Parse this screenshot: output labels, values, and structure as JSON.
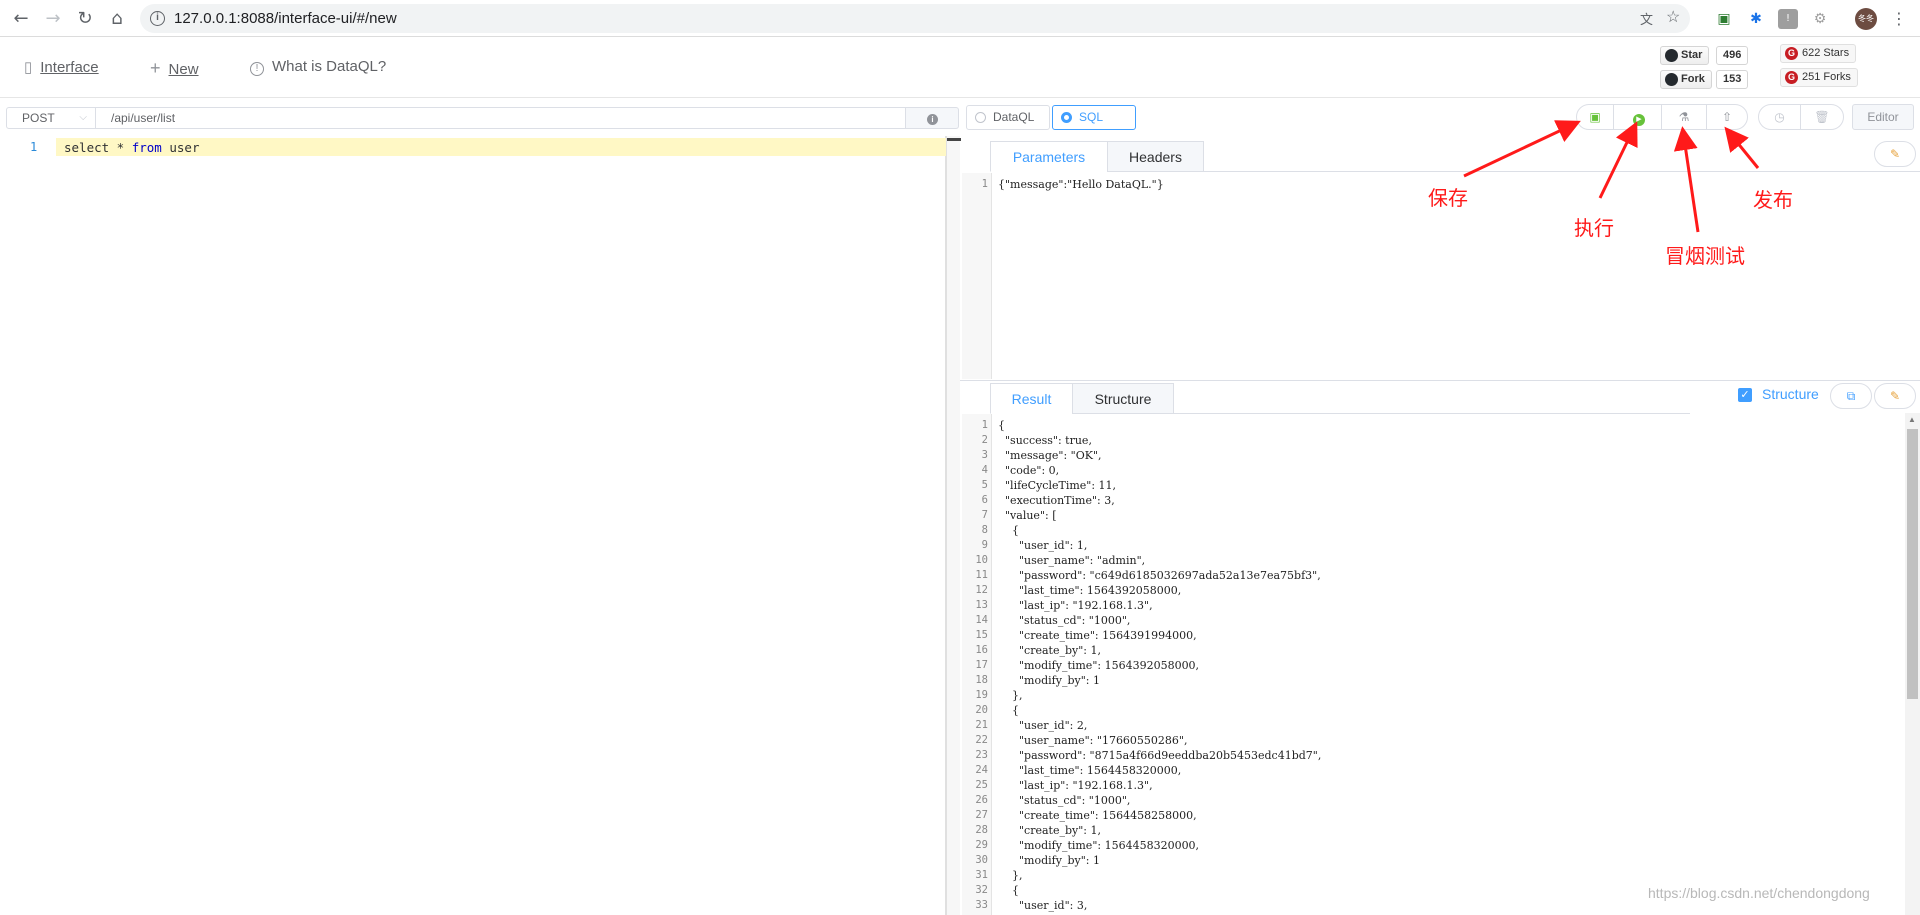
{
  "browser": {
    "url": "127.0.0.1:8088/interface-ui/#/new",
    "avatar_text": "冬冬"
  },
  "header": {
    "menu": [
      {
        "label": "Interface",
        "icon": "document-icon"
      },
      {
        "label": "New",
        "icon": "plus-icon"
      },
      {
        "label": "What is DataQL?",
        "icon": "info-circle-icon"
      }
    ],
    "github": {
      "star_label": "Star",
      "star_count": "496",
      "fork_label": "Fork",
      "fork_count": "153"
    },
    "gitee": {
      "stars": "622 Stars",
      "forks": "251 Forks"
    }
  },
  "request": {
    "method": "POST",
    "path": "/api/user/list"
  },
  "mode": {
    "options": [
      "DataQL",
      "SQL"
    ],
    "selected": "SQL"
  },
  "toolbar": {
    "editor_label": "Editor"
  },
  "editor": {
    "line_number": "1",
    "code_parts": [
      "select * ",
      "from",
      " user"
    ]
  },
  "params_pane": {
    "tabs": [
      "Parameters",
      "Headers"
    ],
    "active_tab": "Parameters",
    "lines": [
      "{\"message\":\"Hello DataQL.\"}"
    ]
  },
  "result_pane": {
    "tabs": [
      "Result",
      "Structure"
    ],
    "active_tab": "Result",
    "structure_checkbox_label": "Structure",
    "structure_checked": true,
    "lines": [
      "{",
      "  \"success\": true,",
      "  \"message\": \"OK\",",
      "  \"code\": 0,",
      "  \"lifeCycleTime\": 11,",
      "  \"executionTime\": 3,",
      "  \"value\": [",
      "    {",
      "      \"user_id\": 1,",
      "      \"user_name\": \"admin\",",
      "      \"password\": \"c649d6185032697ada52a13e7ea75bf3\",",
      "      \"last_time\": 1564392058000,",
      "      \"last_ip\": \"192.168.1.3\",",
      "      \"status_cd\": \"1000\",",
      "      \"create_time\": 1564391994000,",
      "      \"create_by\": 1,",
      "      \"modify_time\": 1564392058000,",
      "      \"modify_by\": 1",
      "    },",
      "    {",
      "      \"user_id\": 2,",
      "      \"user_name\": \"17660550286\",",
      "      \"password\": \"8715a4f66d9eeddba20b5453edc41bd7\",",
      "      \"last_time\": 1564458320000,",
      "      \"last_ip\": \"192.168.1.3\",",
      "      \"status_cd\": \"1000\",",
      "      \"create_time\": 1564458258000,",
      "      \"create_by\": 1,",
      "      \"modify_time\": 1564458320000,",
      "      \"modify_by\": 1",
      "    },",
      "    {",
      "      \"user_id\": 3,"
    ]
  },
  "annotations": {
    "save": "保存",
    "execute": "执行",
    "smoke_test": "冒烟测试",
    "publish": "发布"
  },
  "watermark": "https://blog.csdn.net/chendongdong",
  "colors": {
    "accent": "#409eff",
    "execute": "#67c23a",
    "annotation": "#ff1a1a"
  }
}
